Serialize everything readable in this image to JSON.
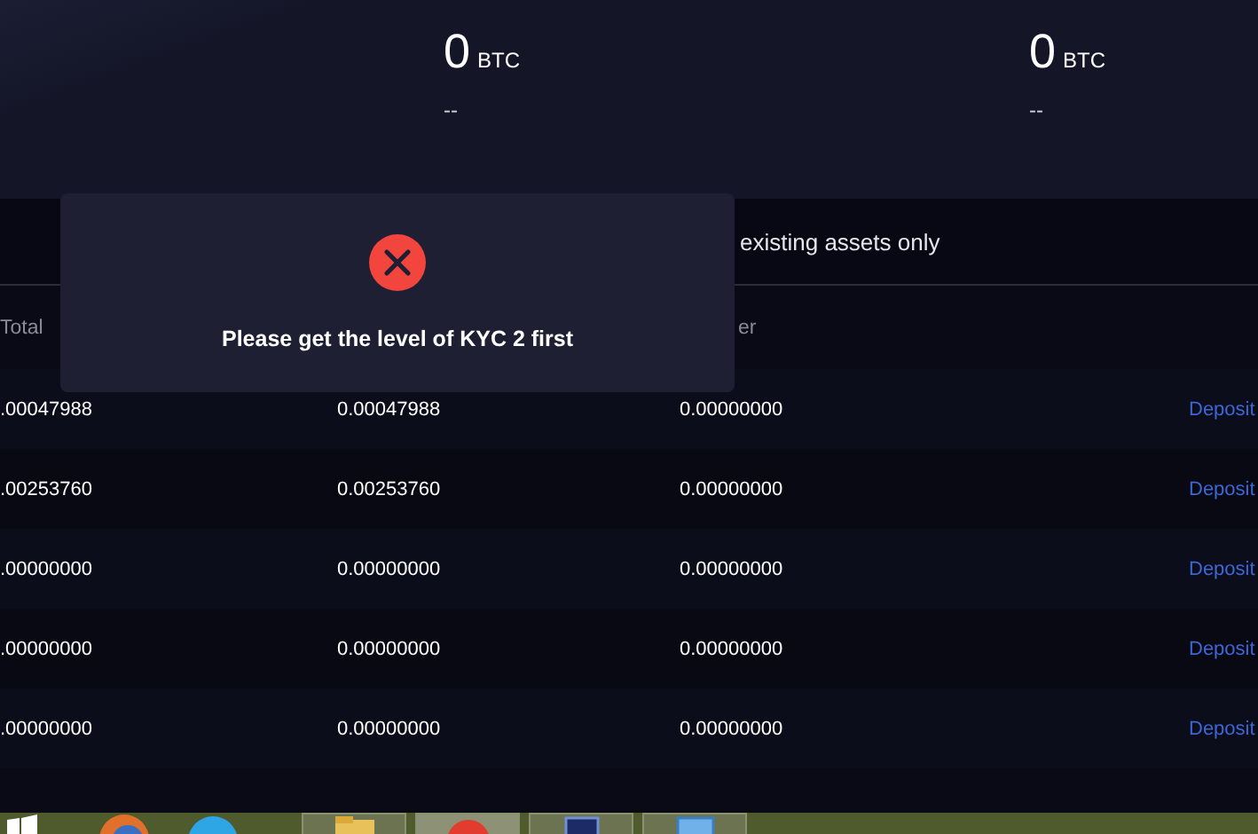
{
  "summary": {
    "items": [
      {
        "amount": "0",
        "unit": "BTC",
        "sub": "--"
      },
      {
        "amount": "0",
        "unit": "BTC",
        "sub": "--"
      }
    ]
  },
  "filter": {
    "label": "existing assets only"
  },
  "table": {
    "columns": {
      "column_1": "Total",
      "column_3": "er"
    },
    "rows": [
      {
        "cells": [
          ".00047988",
          "0.00047988",
          "0.00000000"
        ],
        "action": "Deposit"
      },
      {
        "cells": [
          ".00253760",
          "0.00253760",
          "0.00000000"
        ],
        "action": "Deposit"
      },
      {
        "cells": [
          ".00000000",
          "0.00000000",
          "0.00000000"
        ],
        "action": "Deposit"
      },
      {
        "cells": [
          ".00000000",
          "0.00000000",
          "0.00000000"
        ],
        "action": "Deposit"
      },
      {
        "cells": [
          ".00000000",
          "0.00000000",
          "0.00000000"
        ],
        "action": "Deposit"
      }
    ]
  },
  "dialog": {
    "message": "Please get the level of KYC 2 first"
  }
}
